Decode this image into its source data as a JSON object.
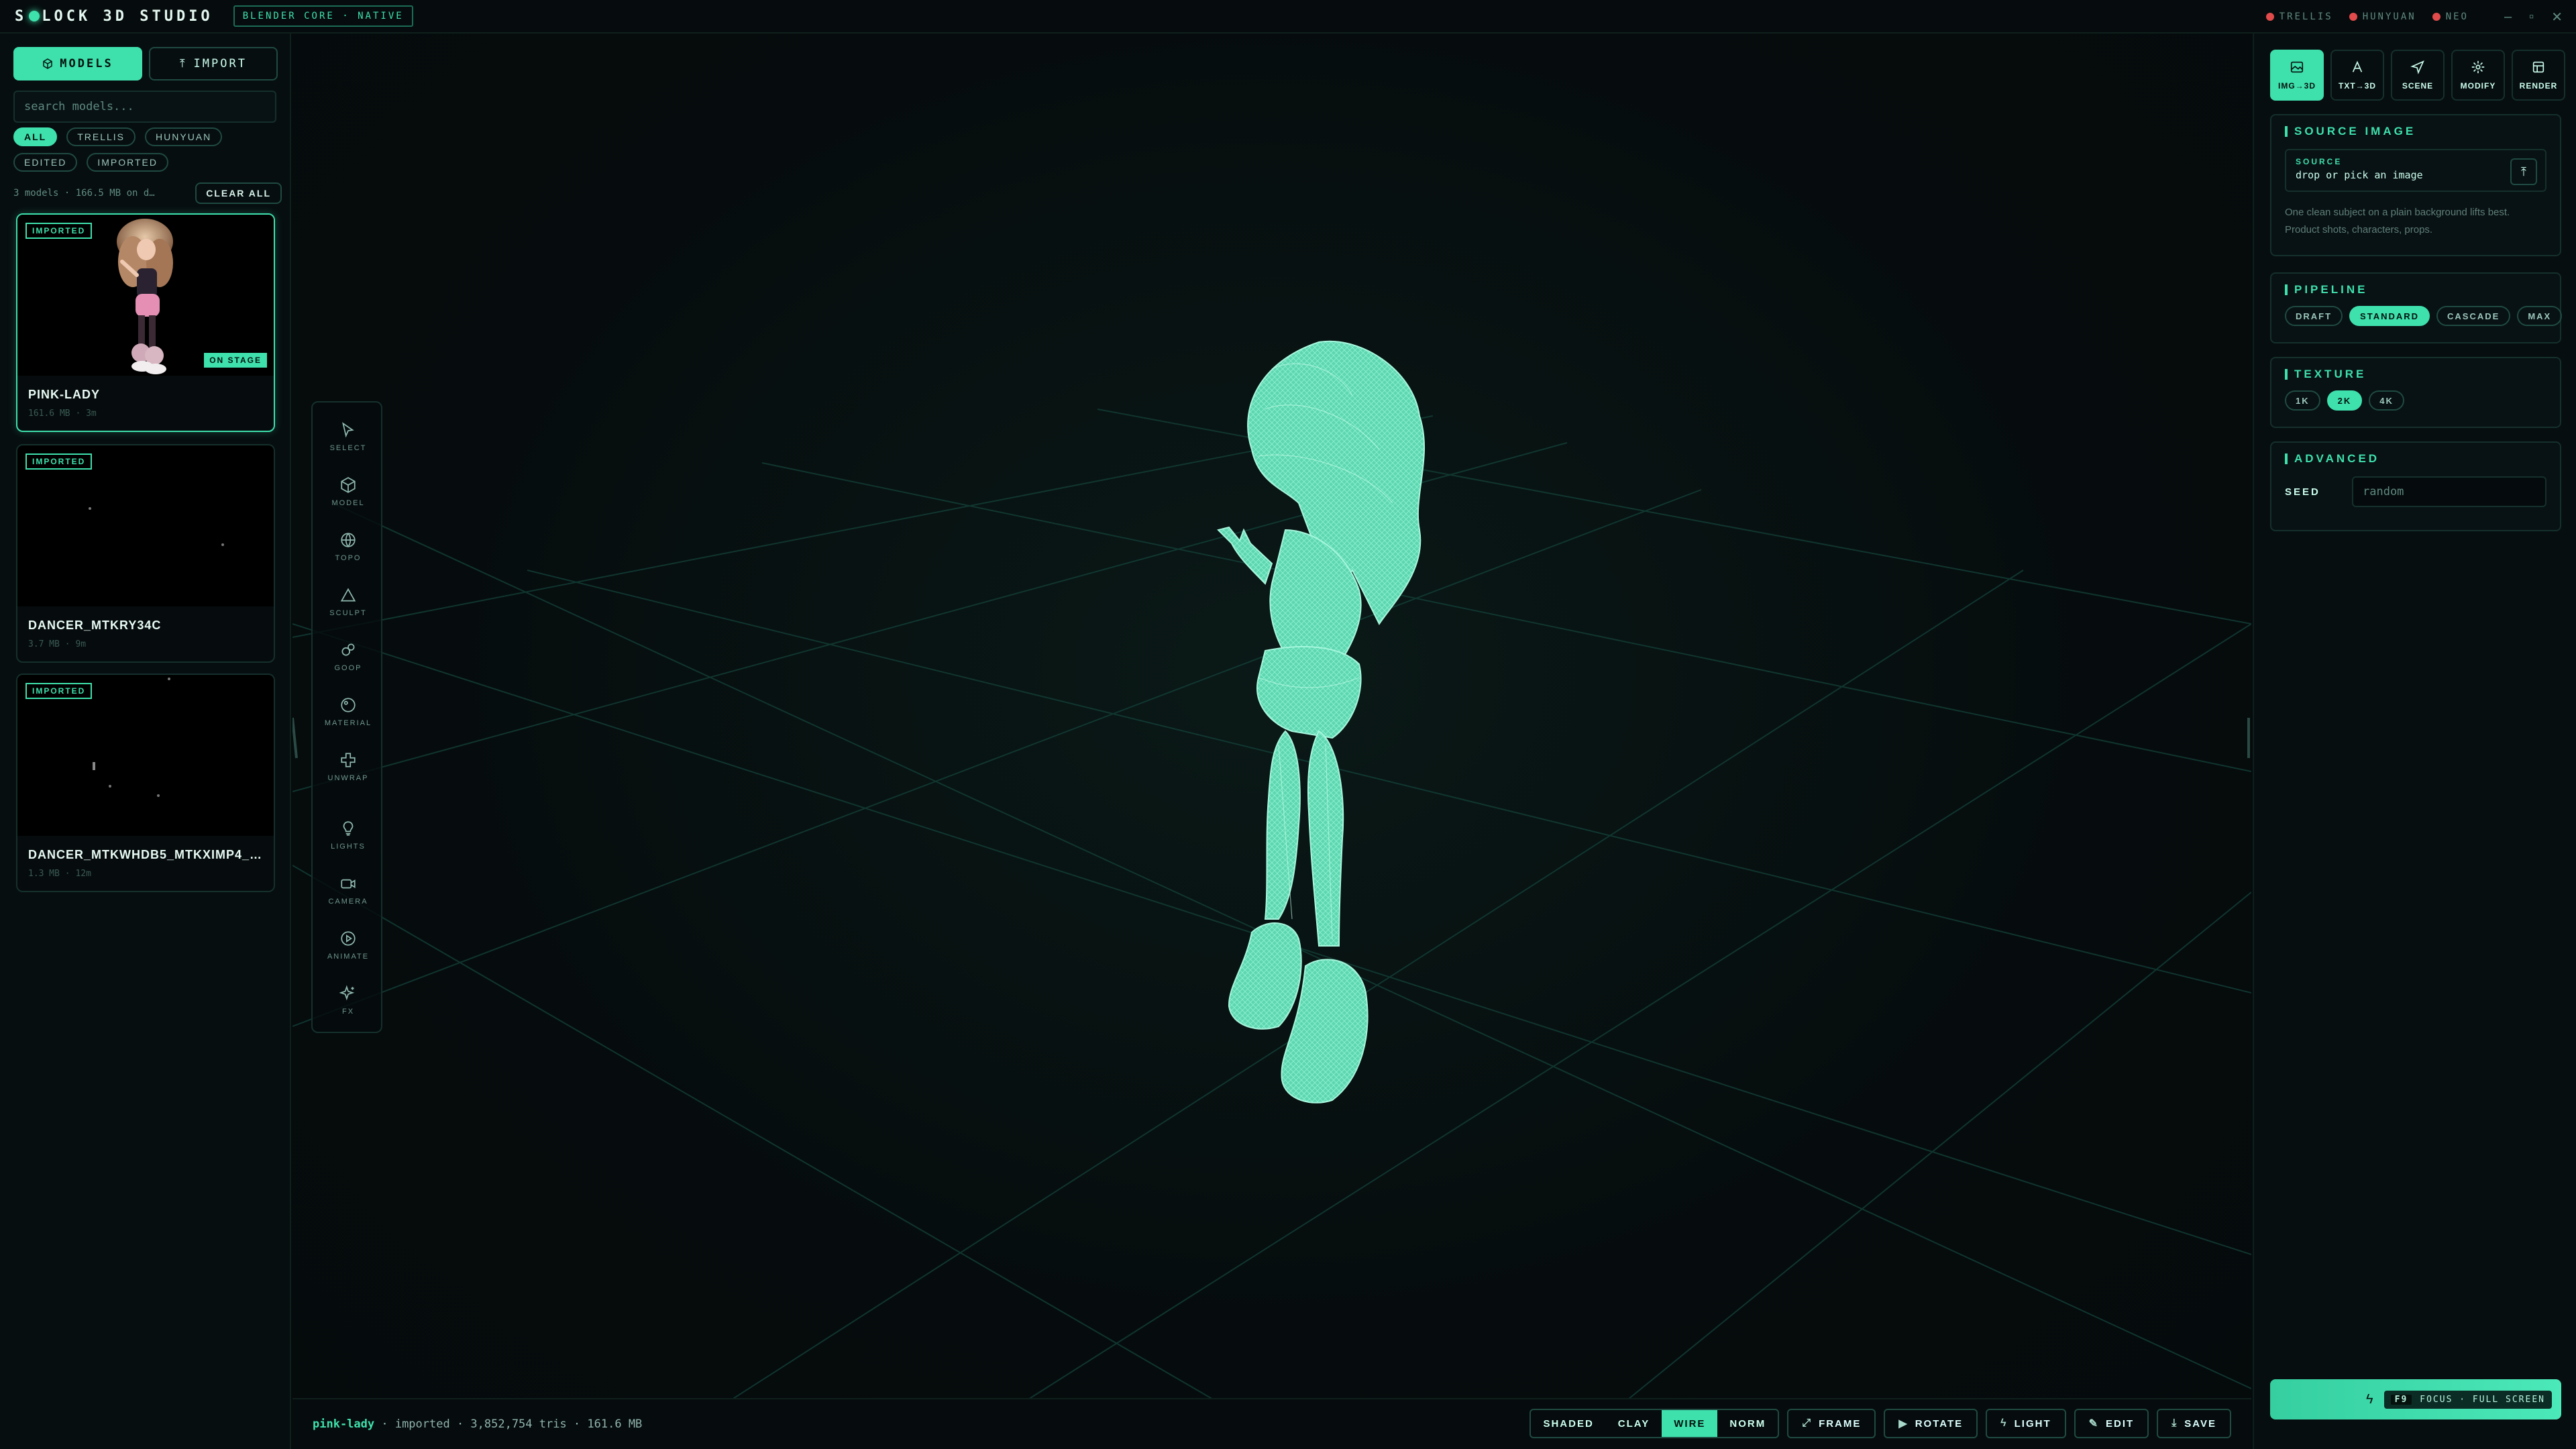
{
  "app": {
    "title": "S LOCK 3D STUDIO",
    "title_pre": "S",
    "title_post": "LOCK 3D STUDIO",
    "engine_badge": "BLENDER CORE · NATIVE",
    "providers": [
      {
        "label": "TRELLIS",
        "color": "#e14b4b"
      },
      {
        "label": "HUNYUAN",
        "color": "#e14b4b"
      },
      {
        "label": "NEO",
        "color": "#e14b4b"
      }
    ],
    "window_controls": [
      "minimize-icon",
      "maximize-icon",
      "close-icon"
    ]
  },
  "left": {
    "tabs": [
      {
        "label": "MODELS",
        "icon": "cube-icon",
        "active": true
      },
      {
        "label": "IMPORT",
        "icon": "upload-icon",
        "active": false
      }
    ],
    "search_placeholder": "search models...",
    "filters": [
      {
        "label": "ALL",
        "active": true
      },
      {
        "label": "TRELLIS",
        "active": false
      },
      {
        "label": "HUNYUAN",
        "active": false
      },
      {
        "label": "EDITED",
        "active": false
      },
      {
        "label": "IMPORTED",
        "active": false
      }
    ],
    "summary": "3 models · 166.5 MB on d…",
    "clear_all": "CLEAR ALL",
    "models": [
      {
        "name": "PINK-LADY",
        "meta": "161.6 MB · 3m",
        "tag": "IMPORTED",
        "stage": "ON STAGE",
        "active": true
      },
      {
        "name": "DANCER_MTKRY34C",
        "meta": "3.7 MB · 9m",
        "tag": "IMPORTED",
        "active": false
      },
      {
        "name": "DANCER_MTKWHDB5_MTKXIMP4_…",
        "meta": "1.3 MB · 12m",
        "tag": "IMPORTED",
        "active": false
      }
    ]
  },
  "tools": [
    {
      "label": "SELECT",
      "icon": "cursor-icon"
    },
    {
      "label": "MODEL",
      "icon": "cube-icon"
    },
    {
      "label": "TOPO",
      "icon": "globe-icon"
    },
    {
      "label": "SCULPT",
      "icon": "triangle-icon"
    },
    {
      "label": "GOOP",
      "icon": "blob-icon"
    },
    {
      "label": "MATERIAL",
      "icon": "sphere-icon"
    },
    {
      "label": "UNWRAP",
      "icon": "unwrap-icon"
    },
    {
      "label": "LIGHTS",
      "icon": "bulb-icon"
    },
    {
      "label": "CAMERA",
      "icon": "camera-icon"
    },
    {
      "label": "ANIMATE",
      "icon": "play-icon"
    },
    {
      "label": "FX",
      "icon": "sparkle-icon"
    }
  ],
  "status": {
    "model": "pink-lady",
    "details": " · imported · 3,852,754 tris · 161.6 MB",
    "view_modes": [
      {
        "label": "SHADED",
        "active": false
      },
      {
        "label": "CLAY",
        "active": false
      },
      {
        "label": "WIRE",
        "active": true
      },
      {
        "label": "NORM",
        "active": false
      }
    ],
    "actions": [
      {
        "label": "FRAME",
        "icon": "⤢"
      },
      {
        "label": "ROTATE",
        "icon": "▶"
      },
      {
        "label": "LIGHT",
        "icon": "ϟ"
      },
      {
        "label": "EDIT",
        "icon": "✎"
      },
      {
        "label": "SAVE",
        "icon": "⤓"
      }
    ]
  },
  "right": {
    "modes": [
      {
        "label": "IMG→3D",
        "icon": "image-icon",
        "active": true
      },
      {
        "label": "TXT→3D",
        "icon": "text-icon",
        "active": false
      },
      {
        "label": "SCENE",
        "icon": "send-icon",
        "active": false
      },
      {
        "label": "MODIFY",
        "icon": "gear-icon",
        "active": false
      },
      {
        "label": "RENDER",
        "icon": "render-icon",
        "active": false
      }
    ],
    "source_image": {
      "title": "SOURCE IMAGE",
      "label": "SOURCE",
      "placeholder": "drop or pick an image",
      "hint": "One clean subject on a plain background lifts best. Product shots, characters, props."
    },
    "pipeline": {
      "title": "PIPELINE",
      "options": [
        {
          "label": "DRAFT",
          "active": false
        },
        {
          "label": "STANDARD",
          "active": true
        },
        {
          "label": "CASCADE",
          "active": false
        },
        {
          "label": "MAX",
          "active": false
        }
      ]
    },
    "texture": {
      "title": "TEXTURE",
      "options": [
        {
          "label": "1K",
          "active": false
        },
        {
          "label": "2K",
          "active": true
        },
        {
          "label": "4K",
          "active": false
        }
      ]
    },
    "advanced": {
      "title": "ADVANCED",
      "seed_label": "SEED",
      "seed_placeholder": "random"
    },
    "generate": {
      "key": "F9",
      "label": "FOCUS · FULL SCREEN"
    }
  }
}
